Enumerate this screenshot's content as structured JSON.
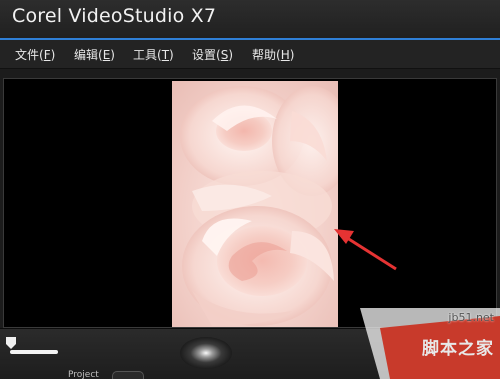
{
  "window": {
    "title": "Corel VideoStudio X7",
    "accent_color": "#2f7fd6"
  },
  "menu": {
    "items": [
      {
        "label": "文件",
        "key": "F"
      },
      {
        "label": "编辑",
        "key": "E"
      },
      {
        "label": "工具",
        "key": "T"
      },
      {
        "label": "设置",
        "key": "S"
      },
      {
        "label": "帮助",
        "key": "H"
      }
    ]
  },
  "preview": {
    "content": "pink rose photo"
  },
  "controls": {
    "project_label": "Project"
  },
  "watermark": {
    "site": "jb51.net",
    "name": "脚本之家"
  }
}
